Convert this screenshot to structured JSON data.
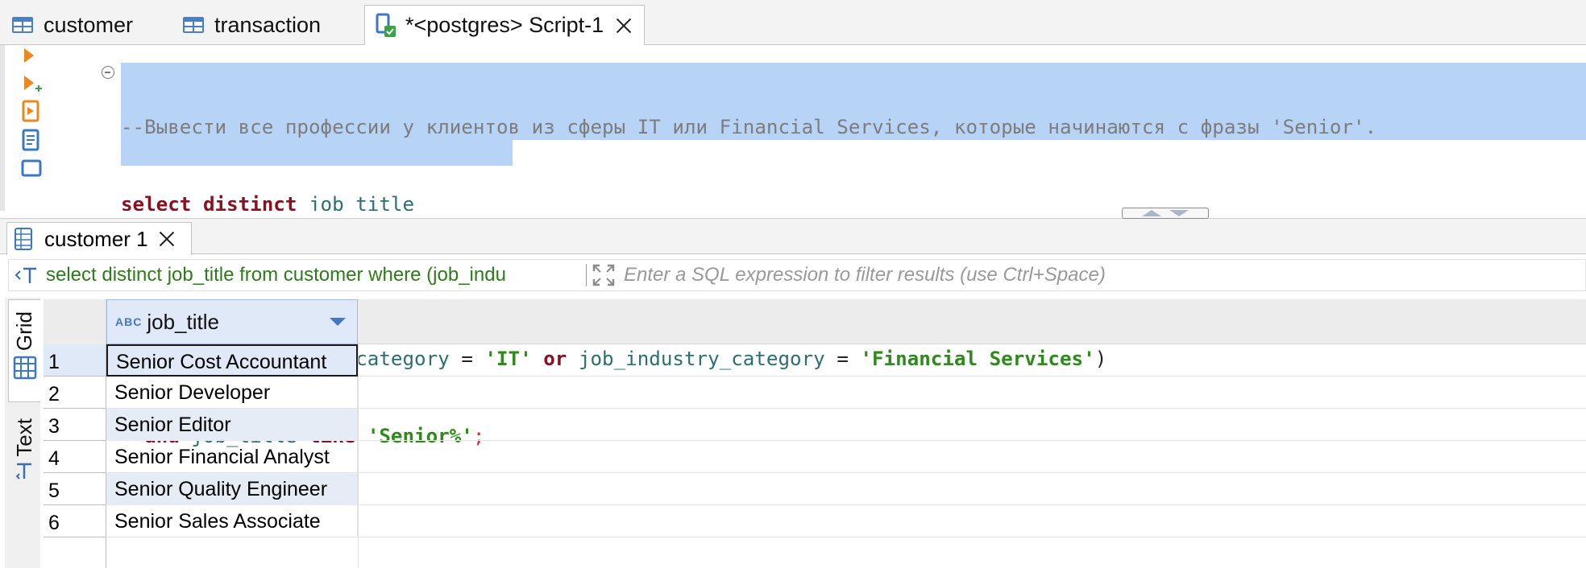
{
  "tabs": [
    {
      "label": "customer",
      "icon": "table-icon"
    },
    {
      "label": "transaction",
      "icon": "table-icon"
    },
    {
      "label": "*<postgres> Script-1",
      "icon": "sql-script-icon",
      "active": true
    }
  ],
  "editor": {
    "comment": "--Вывести все профессии у клиентов из сферы IT или Financial Services, которые начинаются с фразы 'Senior'.",
    "kw_select": "select",
    "kw_distinct": "distinct",
    "col_job_title": "job_title",
    "kw_from": "from",
    "tbl_customer": "customer",
    "kw_where": "where",
    "paren_open": "(",
    "col_industry": "job_industry_category",
    "op_eq": "=",
    "str_it": "'IT'",
    "kw_or": "or",
    "str_fin": "'Financial Services'",
    "paren_close": ")",
    "kw_and": "and",
    "kw_like": "like",
    "str_senior": "'Senior%'",
    "semicolon": ";"
  },
  "results": {
    "tab_label": "customer 1",
    "filter_query": "select distinct job_title from customer where (job_indu",
    "filter_placeholder": "Enter a SQL expression to filter results (use Ctrl+Space)",
    "side_tabs": [
      "Grid",
      "Text"
    ],
    "column": {
      "name": "job_title",
      "type_badge": "ABC"
    },
    "rows": [
      {
        "num": "1",
        "value": "Senior Cost Accountant"
      },
      {
        "num": "2",
        "value": "Senior Developer"
      },
      {
        "num": "3",
        "value": "Senior Editor"
      },
      {
        "num": "4",
        "value": "Senior Financial Analyst"
      },
      {
        "num": "5",
        "value": "Senior Quality Engineer"
      },
      {
        "num": "6",
        "value": "Senior Sales Associate"
      }
    ]
  },
  "colors": {
    "selection": "#b7d3f6",
    "keyword": "#8a0f1f",
    "string": "#2e8a1a",
    "table": "#8a22b8",
    "column": "#2b6f73",
    "comment": "#7d7d7d"
  }
}
